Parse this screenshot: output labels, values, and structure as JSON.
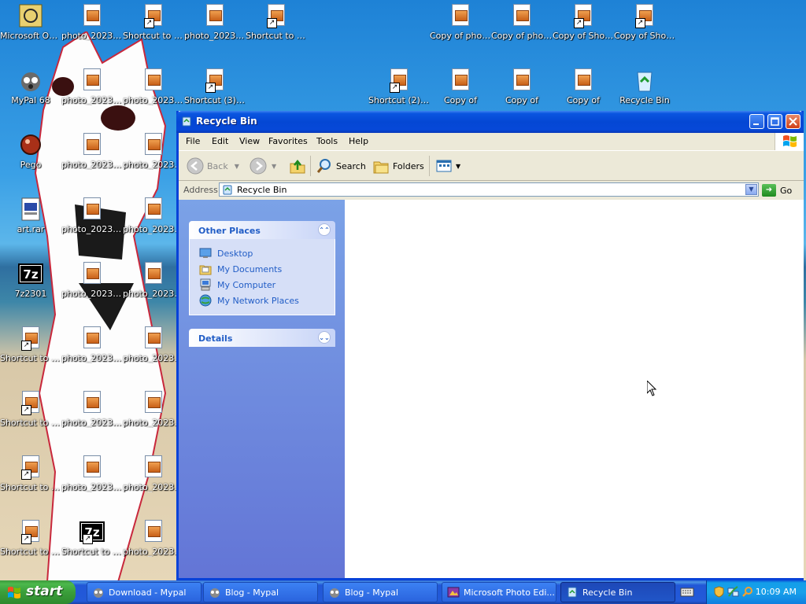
{
  "desktop": {
    "icons": [
      {
        "label": "Microsoft Outlook",
        "type": "outlook"
      },
      {
        "label": "photo_2023-...",
        "type": "photo"
      },
      {
        "label": "Shortcut to photo_2023-...",
        "type": "photo-shortcut"
      },
      {
        "label": "photo_2023-...",
        "type": "photo"
      },
      {
        "label": "Shortcut to photo_2023-...",
        "type": "photo-shortcut"
      },
      {
        "label": "Copy of photo_2023-...",
        "type": "photo"
      },
      {
        "label": "Copy of photo_2023-...",
        "type": "photo"
      },
      {
        "label": "Copy of Shortcut (3) ...",
        "type": "photo-shortcut"
      },
      {
        "label": "Copy of Shortcut to ...",
        "type": "photo-shortcut"
      },
      {
        "label": "MyPal 68",
        "type": "mypal"
      },
      {
        "label": "photo_2023-...",
        "type": "photo"
      },
      {
        "label": "photo_2023-...",
        "type": "photo"
      },
      {
        "label": "Shortcut (3) to",
        "type": "photo-shortcut"
      },
      {
        "label": "Shortcut (2) to",
        "type": "photo-shortcut"
      },
      {
        "label": "Copy of",
        "type": "photo"
      },
      {
        "label": "Copy of",
        "type": "photo"
      },
      {
        "label": "Copy of",
        "type": "photo"
      },
      {
        "label": "Recycle Bin",
        "type": "recycle"
      },
      {
        "label": "Pego",
        "type": "pego"
      },
      {
        "label": "photo_2023-...",
        "type": "photo"
      },
      {
        "label": "photo_2023-...",
        "type": "photo"
      },
      {
        "label": "art.rar",
        "type": "rar"
      },
      {
        "label": "photo_2023-...",
        "type": "photo"
      },
      {
        "label": "photo_2023-...",
        "type": "photo"
      },
      {
        "label": "7z2301",
        "type": "7z"
      },
      {
        "label": "photo_2023-...",
        "type": "photo"
      },
      {
        "label": "photo_2023-...",
        "type": "photo"
      },
      {
        "label": "Shortcut to photo_2023-...",
        "type": "photo-shortcut"
      },
      {
        "label": "photo_2023-...",
        "type": "photo"
      },
      {
        "label": "photo_2023-...",
        "type": "photo"
      },
      {
        "label": "Shortcut to photo_2023-...",
        "type": "photo-shortcut"
      },
      {
        "label": "photo_2023-...",
        "type": "photo"
      },
      {
        "label": "photo_2023-...",
        "type": "photo"
      },
      {
        "label": "Shortcut to photo_2023-...",
        "type": "photo-shortcut"
      },
      {
        "label": "photo_2023-...",
        "type": "photo"
      },
      {
        "label": "photo_2023-...",
        "type": "photo"
      },
      {
        "label": "Shortcut to photo_2023-...",
        "type": "photo-shortcut"
      },
      {
        "label": "Shortcut to 7z2301",
        "type": "7z-shortcut"
      },
      {
        "label": "photo_2023-...",
        "type": "photo"
      }
    ]
  },
  "window": {
    "title": "Recycle Bin",
    "menu": [
      "File",
      "Edit",
      "View",
      "Favorites",
      "Tools",
      "Help"
    ],
    "toolbar": {
      "back": "Back",
      "search": "Search",
      "folders": "Folders"
    },
    "address": {
      "label": "Address",
      "value": "Recycle Bin",
      "go": "Go"
    },
    "taskpane": {
      "other_places": {
        "title": "Other Places",
        "links": [
          "Desktop",
          "My Documents",
          "My Computer",
          "My Network Places"
        ]
      },
      "details": {
        "title": "Details"
      }
    }
  },
  "taskbar": {
    "start": "start",
    "tasks": [
      {
        "label": "Download - Mypal",
        "active": false
      },
      {
        "label": "Blog - Mypal",
        "active": false
      },
      {
        "label": "Blog - Mypal",
        "active": false
      },
      {
        "label": "Microsoft Photo Edi...",
        "active": false
      },
      {
        "label": "Recycle Bin",
        "active": true
      }
    ],
    "clock": "10:09 AM"
  },
  "colors": {
    "title_bar": "#0447d4",
    "taskpane_link": "#215dc6",
    "start_green": "#3a9e3a",
    "taskbar_blue": "#235ad8"
  }
}
